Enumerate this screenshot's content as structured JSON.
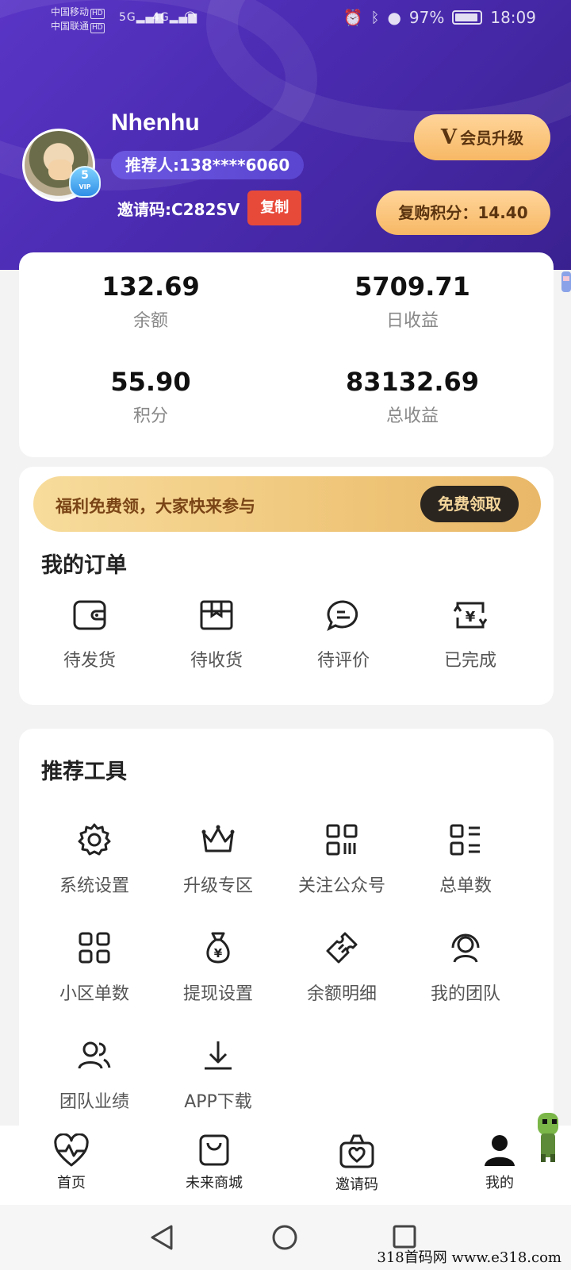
{
  "status_bar": {
    "carrier1": "中国移动",
    "carrier2": "中国联通",
    "hd": "HD",
    "signal1": "5G",
    "signal2": "4G",
    "battery": "97%",
    "time": "18:09"
  },
  "profile": {
    "username": "Nhenhu",
    "referrer": "推荐人:138****6060",
    "invite_code": "邀请码:C282SV",
    "copy_label": "复制",
    "vip_level": "5",
    "vip_text": "VIP",
    "upgrade_v": "V",
    "upgrade_label": "会员升级",
    "points_label": "复购积分：14.40"
  },
  "stats": [
    {
      "value": "132.69",
      "label": "余额"
    },
    {
      "value": "5709.71",
      "label": "日收益"
    },
    {
      "value": "55.90",
      "label": "积分"
    },
    {
      "value": "83132.69",
      "label": "总收益"
    }
  ],
  "banner": {
    "text": "福利免费领，大家快来参与",
    "button": "免费领取"
  },
  "orders": {
    "title": "我的订单",
    "items": [
      {
        "label": "待发货",
        "icon": "wallet-icon"
      },
      {
        "label": "待收货",
        "icon": "box-icon"
      },
      {
        "label": "待评价",
        "icon": "chat-icon"
      },
      {
        "label": "已完成",
        "icon": "yen-exchange-icon"
      }
    ]
  },
  "tools": {
    "title": "推荐工具",
    "items": [
      {
        "label": "系统设置",
        "icon": "gear-icon"
      },
      {
        "label": "升级专区",
        "icon": "crown-icon"
      },
      {
        "label": "关注公众号",
        "icon": "qrcode-icon"
      },
      {
        "label": "总单数",
        "icon": "list-icon"
      },
      {
        "label": "小区单数",
        "icon": "grid-icon"
      },
      {
        "label": "提现设置",
        "icon": "money-bag-icon"
      },
      {
        "label": "余额明细",
        "icon": "ticket-icon"
      },
      {
        "label": "我的团队",
        "icon": "support-icon"
      },
      {
        "label": "团队业绩",
        "icon": "team-icon"
      },
      {
        "label": "APP下载",
        "icon": "download-icon"
      }
    ]
  },
  "tabbar": [
    {
      "label": "首页",
      "icon": "heart-pulse-icon"
    },
    {
      "label": "未来商城",
      "icon": "shopping-bag-icon"
    },
    {
      "label": "邀请码",
      "icon": "gift-bag-icon"
    },
    {
      "label": "我的",
      "icon": "person-icon"
    }
  ],
  "watermark": "318首码网 www.e318.com"
}
